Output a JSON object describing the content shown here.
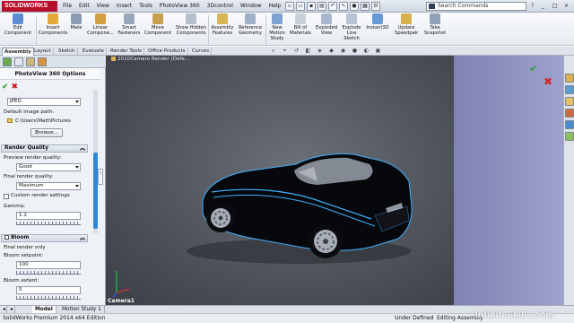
{
  "app": {
    "logo_text": "SOLIDWORKS",
    "menu": [
      "File",
      "Edit",
      "View",
      "Insert",
      "Tools",
      "PhotoView 360",
      "3Dcontrol",
      "Window",
      "Help"
    ],
    "search_placeholder": "Search Commands",
    "search_help": "?",
    "window_controls": [
      "_",
      "□",
      "×"
    ]
  },
  "commands": [
    {
      "label": "Edit Component",
      "icon": "edit-component-icon"
    },
    {
      "label": "Insert Components",
      "icon": "insert-components-icon"
    },
    {
      "label": "Mate",
      "icon": "mate-icon"
    },
    {
      "label": "Linear Compone...",
      "icon": "linear-pattern-icon"
    },
    {
      "label": "Smart Fasteners",
      "icon": "smart-fasteners-icon"
    },
    {
      "label": "Move Component",
      "icon": "move-component-icon"
    },
    {
      "label": "Show Hidden Components",
      "icon": "show-hidden-icon"
    },
    {
      "label": "Assembly Features",
      "icon": "assembly-features-icon"
    },
    {
      "label": "Reference Geometry",
      "icon": "reference-geometry-icon"
    },
    {
      "label": "New Motion Study",
      "icon": "motion-study-icon"
    },
    {
      "label": "Bill of Materials",
      "icon": "bom-icon"
    },
    {
      "label": "Exploded View",
      "icon": "exploded-view-icon"
    },
    {
      "label": "Explode Line Sketch",
      "icon": "explode-line-icon"
    },
    {
      "label": "Instant3D",
      "icon": "instant3d-icon"
    },
    {
      "label": "Update Speedpak",
      "icon": "speedpak-icon"
    },
    {
      "label": "Take Snapshot",
      "icon": "snapshot-icon"
    }
  ],
  "cm_tabs": [
    "Assembly",
    "Layout",
    "Sketch",
    "Evaluate",
    "Render Tools",
    "Office Products",
    "Curves"
  ],
  "property_manager": {
    "title": "PhotoView 360 Options",
    "format_value": "JPEG",
    "default_path_label": "Default image path:",
    "default_path_value": "C:\\Users\\Matt\\Pictures",
    "browse_label": "Browse...",
    "render_quality": {
      "header": "Render Quality",
      "preview_label": "Preview render quality:",
      "preview_value": "Good",
      "final_label": "Final render quality:",
      "final_value": "Maximum",
      "custom_label": "Custom render settings",
      "gamma_label": "Gamma:",
      "gamma_value": "1.2"
    },
    "bloom": {
      "header": "Bloom",
      "final_only_label": "Final render only",
      "setpoint_label": "Bloom setpoint:",
      "setpoint_value": "100",
      "extent_label": "Bloom extent:",
      "extent_value": "5"
    }
  },
  "viewport": {
    "title": "2010Camaro Render (Defa...",
    "camera_label": "Camera1"
  },
  "bottom_tabs": [
    "Model",
    "Motion Study 1"
  ],
  "status": {
    "left": "SolidWorks Premium 2014 x64 Edition",
    "under_defined": "Under Defined",
    "mode": "Editing Assembly"
  },
  "watermark": "InfiniteSkills.com",
  "colors": {
    "brand": "#b7102b",
    "accent": "#2f86d6",
    "ok_green": "#1c9a24",
    "cancel_red": "#c7141a",
    "car_body": "#07080b",
    "car_stripe": "#3fb0ff"
  }
}
